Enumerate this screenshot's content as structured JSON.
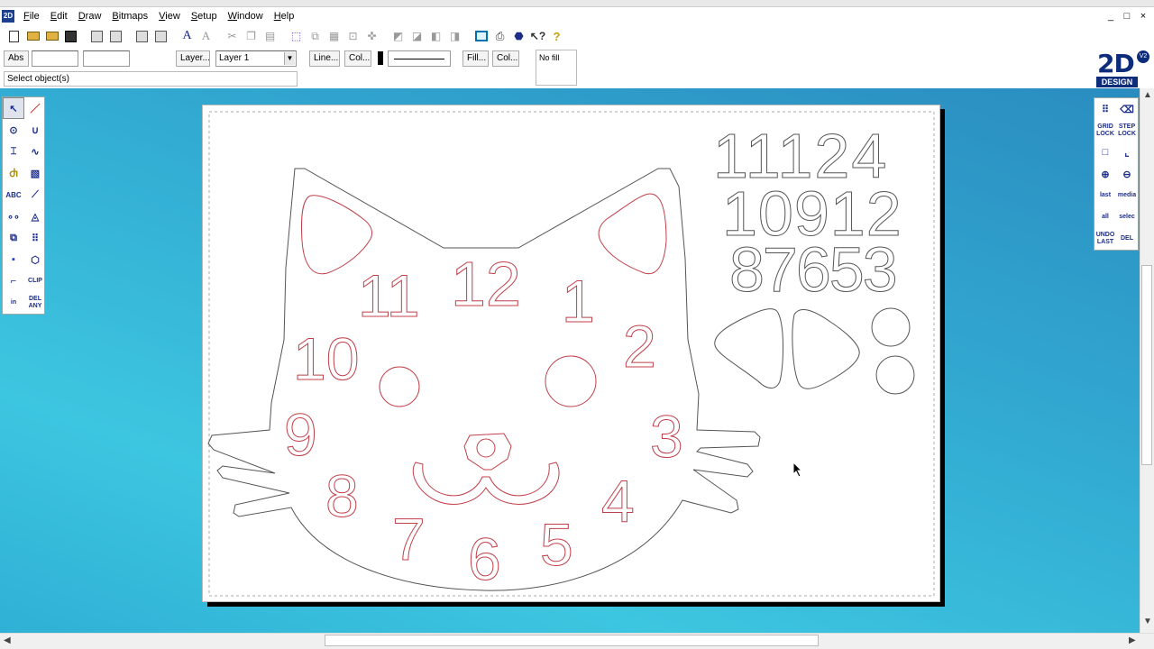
{
  "app": {
    "icon_label": "2D",
    "window_controls": [
      "_",
      "□",
      "×"
    ]
  },
  "menu": [
    "File",
    "Edit",
    "Draw",
    "Bitmaps",
    "View",
    "Setup",
    "Window",
    "Help"
  ],
  "propbar": {
    "abs_label": "Abs",
    "layer_button": "Layer...",
    "layer_value": "Layer 1",
    "line_button": "Line...",
    "line_color_button": "Col...",
    "fill_button": "Fill...",
    "fill_color_button": "Col...",
    "fill_value": "No fill"
  },
  "status": "Select object(s)",
  "logo": {
    "text": "2D",
    "version": "V2",
    "subtitle": "DESIGN"
  },
  "left_tools": [
    "↖",
    "／",
    "⊙",
    "∪",
    "⌶",
    "∿",
    "Ⴛ",
    "▧",
    "ABC",
    "⟋",
    "∘∘",
    "◬",
    "⧉",
    "⠿",
    "▪",
    "⬡",
    "⌐",
    "CLIP",
    "in",
    "DEL ANY"
  ],
  "right_tools": {
    "grid_lock": "GRID LOCK",
    "step_lock": "STEP LOCK",
    "last": "last",
    "median": "media",
    "all": "all",
    "select": "selec",
    "undo_last": "UNDO LAST",
    "del": "DEL"
  },
  "drawing": {
    "colors": {
      "outline": "#555555",
      "red": "#c0404a"
    },
    "dial_numbers": [
      "12",
      "1",
      "2",
      "3",
      "4",
      "5",
      "6",
      "7",
      "8",
      "9",
      "10",
      "11"
    ],
    "spare_rows": [
      "11124",
      "10912",
      "87653"
    ]
  }
}
